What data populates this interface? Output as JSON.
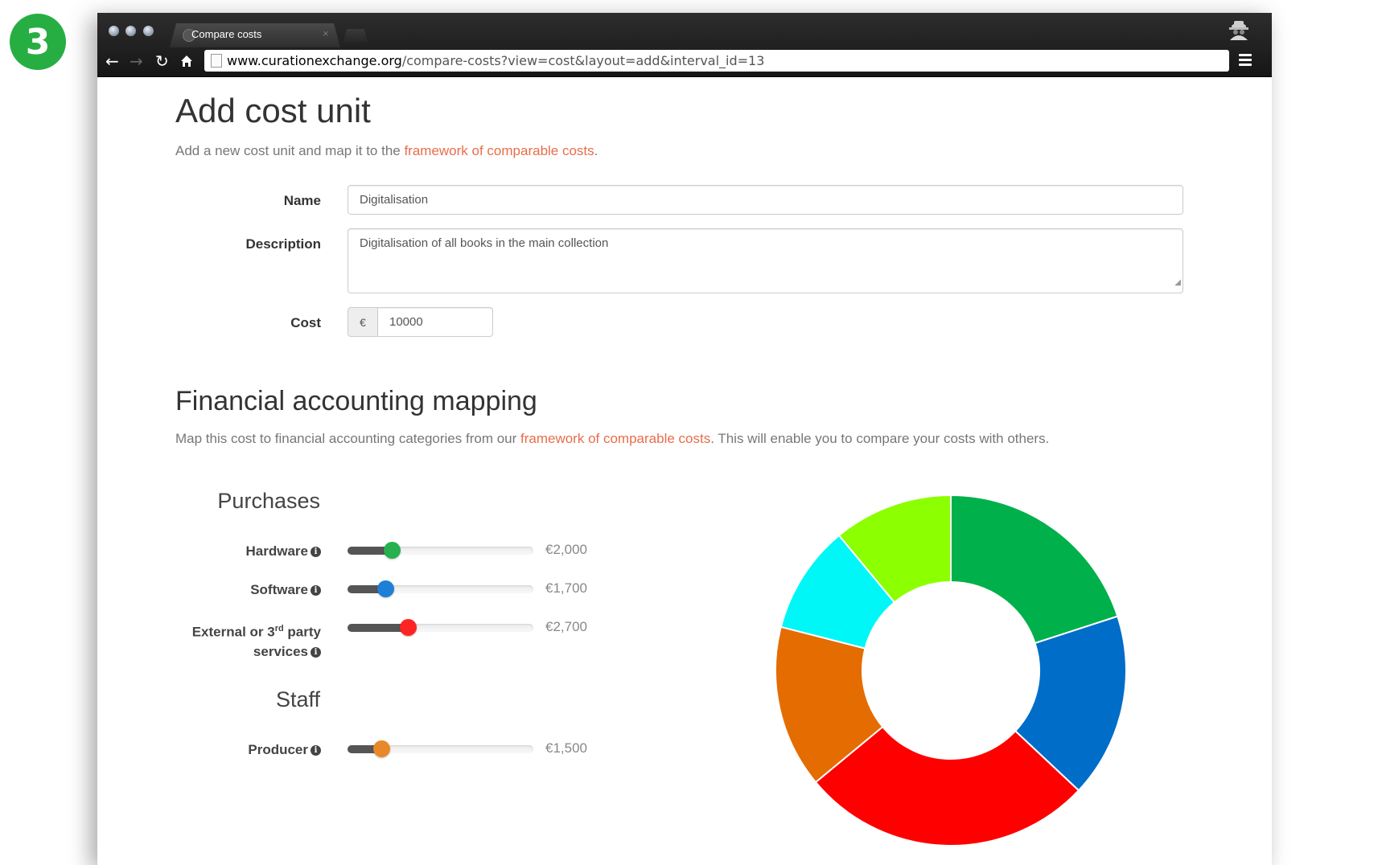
{
  "step_number": "3",
  "browser": {
    "tab_title": "Compare costs",
    "tab_close": "×",
    "url_host": "www.curationexchange.org",
    "url_path": "/compare-costs?view=cost&layout=add&interval_id=13"
  },
  "page": {
    "title": "Add cost unit",
    "intro_prefix": "Add a new cost unit and map it to the ",
    "intro_link": "framework of comparable costs",
    "intro_suffix": ".",
    "form": {
      "name_label": "Name",
      "name_value": "Digitalisation",
      "description_label": "Description",
      "description_value": "Digitalisation of all books in the main collection",
      "cost_label": "Cost",
      "currency_symbol": "€",
      "cost_value": "10000"
    },
    "mapping": {
      "title": "Financial accounting mapping",
      "intro_prefix": "Map this cost to financial accounting categories from our ",
      "intro_link": "framework of comparable costs",
      "intro_suffix": ". This will enable you to compare your costs with others."
    },
    "sections": {
      "purchases": "Purchases",
      "staff": "Staff"
    },
    "sliders": {
      "hardware": {
        "label": "Hardware",
        "value_text": "€2,000",
        "fraction": 0.2,
        "color": "#26b050"
      },
      "software": {
        "label": "Software",
        "value_text": "€1,700",
        "fraction": 0.17,
        "color": "#1e7fd6"
      },
      "external": {
        "label_line1_pre": "External or 3",
        "label_sup": "rd",
        "label_line1_post": " party",
        "label_line2": "services",
        "value_text": "€2,700",
        "fraction": 0.27,
        "color": "#ff2424"
      },
      "producer": {
        "label": "Producer",
        "value_text": "€1,500",
        "fraction": 0.15,
        "color": "#e8882a"
      }
    },
    "info_icon_glyph": "i"
  },
  "donut_segments": [
    {
      "name": "green",
      "color": "#00b04a",
      "value": 20
    },
    {
      "name": "blue",
      "color": "#006dc8",
      "value": 17
    },
    {
      "name": "red",
      "color": "#ff0000",
      "value": 27
    },
    {
      "name": "orange",
      "color": "#e46c00",
      "value": 15
    },
    {
      "name": "cyan",
      "color": "#00f7f7",
      "value": 10
    },
    {
      "name": "lime",
      "color": "#8cff00",
      "value": 11
    }
  ]
}
